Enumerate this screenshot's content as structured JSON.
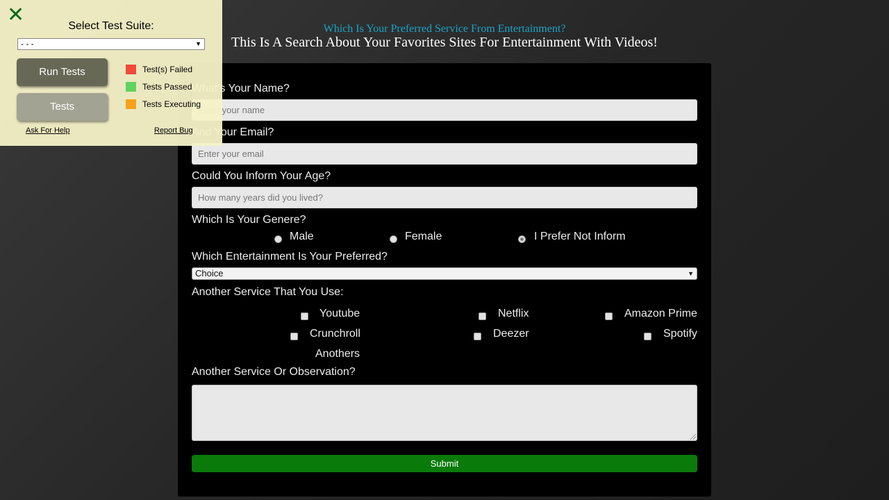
{
  "header": {
    "title": "Which Is Your Preferred Service From Entertainment?",
    "subtitle": "This Is A Search About Your Favorites Sites For Entertainment With Videos!"
  },
  "form": {
    "name": {
      "label": "What's Your Name?",
      "placeholder": "Enter your name"
    },
    "email": {
      "label": "And Your Email?",
      "placeholder": "Enter your email"
    },
    "age": {
      "label": "Could You Inform Your Age?",
      "placeholder": "How many years did you lived?"
    },
    "gender": {
      "label": "Which Is Your Genere?",
      "options": [
        "Male",
        "Female",
        "I Prefer Not Inform"
      ],
      "selected": "I Prefer Not Inform"
    },
    "entertainment": {
      "label": "Which Entertainment Is Your Preferred?",
      "value": "Choice"
    },
    "services": {
      "label": "Another Service That You Use:",
      "options": [
        "Youtube",
        "Netflix",
        "Amazon Prime",
        "Crunchroll",
        "Deezer",
        "Spotify",
        "Anothers"
      ]
    },
    "observation": {
      "label": "Another Service Or Observation?"
    },
    "submit_label": "Submit"
  },
  "test_panel": {
    "close_glyph": "✕",
    "heading": "Select Test Suite:",
    "suite_value": "- - -",
    "run_label": "Run Tests",
    "tests_label": "Tests",
    "legend": [
      {
        "label": "Test(s) Failed",
        "color": "#f04a3a"
      },
      {
        "label": "Tests Passed",
        "color": "#5fd35f"
      },
      {
        "label": "Tests Executing",
        "color": "#f6a21a"
      }
    ],
    "help_label": "Ask For Help",
    "bug_label": "Report Bug"
  }
}
